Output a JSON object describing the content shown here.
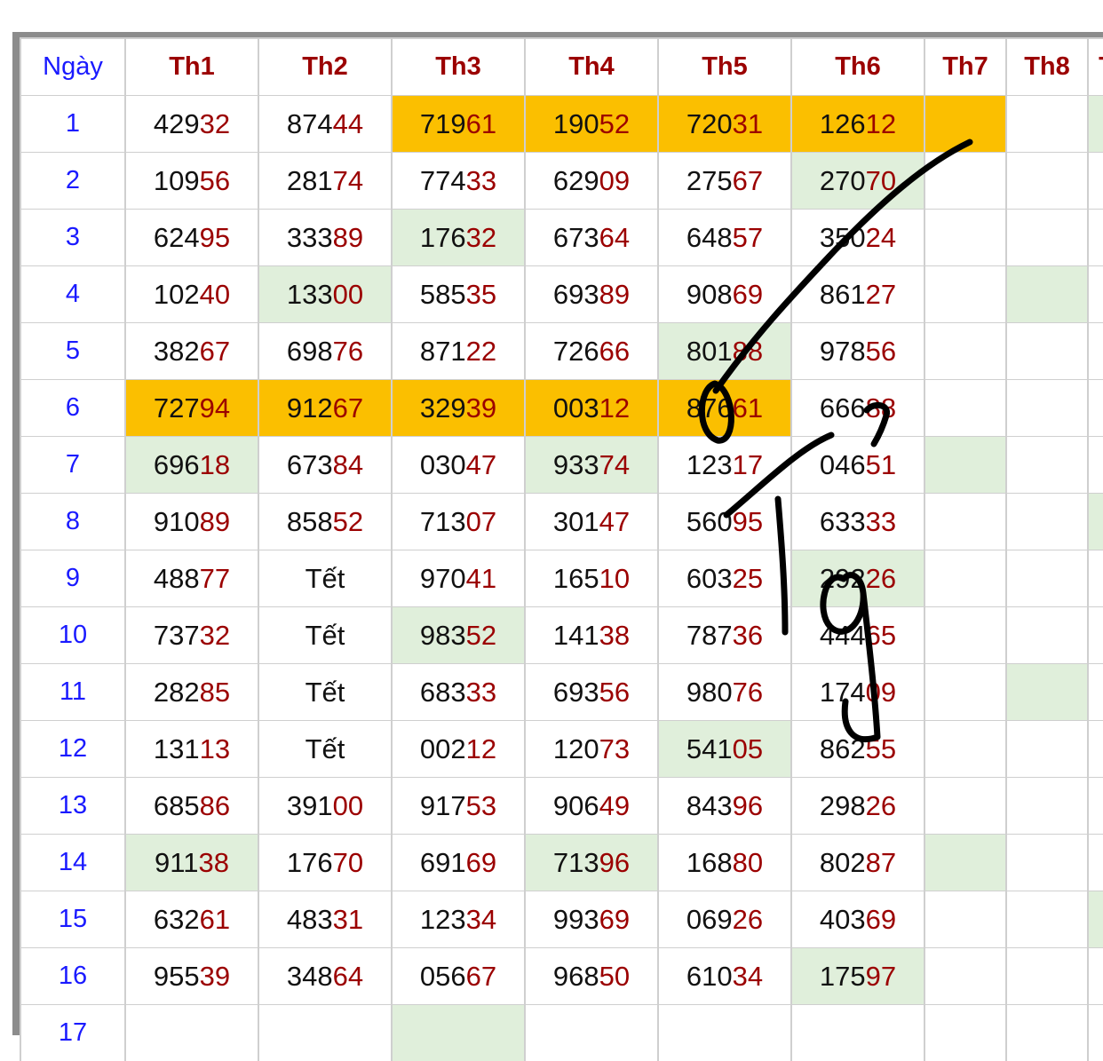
{
  "table": {
    "headers": [
      "Ngày",
      "Th1",
      "Th2",
      "Th3",
      "Th4",
      "Th5",
      "Th6",
      "Th7",
      "Th8",
      "T"
    ],
    "rows": [
      {
        "day": "1",
        "cells": [
          [
            "429",
            "32"
          ],
          [
            "874",
            "44"
          ],
          [
            "719",
            "61"
          ],
          [
            "190",
            "52"
          ],
          [
            "720",
            "31"
          ],
          [
            "126",
            "12"
          ],
          [
            "",
            ""
          ],
          [
            "",
            ""
          ],
          [
            "",
            ""
          ]
        ]
      },
      {
        "day": "2",
        "cells": [
          [
            "109",
            "56"
          ],
          [
            "281",
            "74"
          ],
          [
            "774",
            "33"
          ],
          [
            "629",
            "09"
          ],
          [
            "275",
            "67"
          ],
          [
            "270",
            "70"
          ],
          [
            "",
            ""
          ],
          [
            "",
            ""
          ],
          [
            "",
            ""
          ]
        ]
      },
      {
        "day": "3",
        "cells": [
          [
            "624",
            "95"
          ],
          [
            "333",
            "89"
          ],
          [
            "176",
            "32"
          ],
          [
            "673",
            "64"
          ],
          [
            "648",
            "57"
          ],
          [
            "350",
            "24"
          ],
          [
            "",
            ""
          ],
          [
            "",
            ""
          ],
          [
            "",
            ""
          ]
        ]
      },
      {
        "day": "4",
        "cells": [
          [
            "102",
            "40"
          ],
          [
            "133",
            "00"
          ],
          [
            "585",
            "35"
          ],
          [
            "693",
            "89"
          ],
          [
            "908",
            "69"
          ],
          [
            "861",
            "27"
          ],
          [
            "",
            ""
          ],
          [
            "",
            ""
          ],
          [
            "",
            ""
          ]
        ]
      },
      {
        "day": "5",
        "cells": [
          [
            "382",
            "67"
          ],
          [
            "698",
            "76"
          ],
          [
            "871",
            "22"
          ],
          [
            "726",
            "66"
          ],
          [
            "801",
            "88"
          ],
          [
            "978",
            "56"
          ],
          [
            "",
            ""
          ],
          [
            "",
            ""
          ],
          [
            "",
            ""
          ]
        ]
      },
      {
        "day": "6",
        "cells": [
          [
            "727",
            "94"
          ],
          [
            "912",
            "67"
          ],
          [
            "329",
            "39"
          ],
          [
            "003",
            "12"
          ],
          [
            "876",
            "61"
          ],
          [
            "666",
            "88"
          ],
          [
            "",
            ""
          ],
          [
            "",
            ""
          ],
          [
            "",
            ""
          ]
        ]
      },
      {
        "day": "7",
        "cells": [
          [
            "696",
            "18"
          ],
          [
            "673",
            "84"
          ],
          [
            "030",
            "47"
          ],
          [
            "933",
            "74"
          ],
          [
            "123",
            "17"
          ],
          [
            "046",
            "51"
          ],
          [
            "",
            ""
          ],
          [
            "",
            ""
          ],
          [
            "",
            ""
          ]
        ]
      },
      {
        "day": "8",
        "cells": [
          [
            "910",
            "89"
          ],
          [
            "858",
            "52"
          ],
          [
            "713",
            "07"
          ],
          [
            "301",
            "47"
          ],
          [
            "560",
            "95"
          ],
          [
            "633",
            "33"
          ],
          [
            "",
            ""
          ],
          [
            "",
            ""
          ],
          [
            "",
            ""
          ]
        ]
      },
      {
        "day": "9",
        "cells": [
          [
            "488",
            "77"
          ],
          [
            "Tết",
            ""
          ],
          [
            "970",
            "41"
          ],
          [
            "165",
            "10"
          ],
          [
            "603",
            "25"
          ],
          [
            "292",
            "26"
          ],
          [
            "",
            ""
          ],
          [
            "",
            ""
          ],
          [
            "",
            ""
          ]
        ]
      },
      {
        "day": "10",
        "cells": [
          [
            "737",
            "32"
          ],
          [
            "Tết",
            ""
          ],
          [
            "983",
            "52"
          ],
          [
            "141",
            "38"
          ],
          [
            "787",
            "36"
          ],
          [
            "444",
            "65"
          ],
          [
            "",
            ""
          ],
          [
            "",
            ""
          ],
          [
            "",
            ""
          ]
        ]
      },
      {
        "day": "11",
        "cells": [
          [
            "282",
            "85"
          ],
          [
            "Tết",
            ""
          ],
          [
            "683",
            "33"
          ],
          [
            "693",
            "56"
          ],
          [
            "980",
            "76"
          ],
          [
            "174",
            "09"
          ],
          [
            "",
            ""
          ],
          [
            "",
            ""
          ],
          [
            "",
            ""
          ]
        ]
      },
      {
        "day": "12",
        "cells": [
          [
            "131",
            "13"
          ],
          [
            "Tết",
            ""
          ],
          [
            "002",
            "12"
          ],
          [
            "120",
            "73"
          ],
          [
            "541",
            "05"
          ],
          [
            "862",
            "55"
          ],
          [
            "",
            ""
          ],
          [
            "",
            ""
          ],
          [
            "",
            ""
          ]
        ]
      },
      {
        "day": "13",
        "cells": [
          [
            "685",
            "86"
          ],
          [
            "391",
            "00"
          ],
          [
            "917",
            "53"
          ],
          [
            "906",
            "49"
          ],
          [
            "843",
            "96"
          ],
          [
            "298",
            "26"
          ],
          [
            "",
            ""
          ],
          [
            "",
            ""
          ],
          [
            "",
            ""
          ]
        ]
      },
      {
        "day": "14",
        "cells": [
          [
            "911",
            "38"
          ],
          [
            "176",
            "70"
          ],
          [
            "691",
            "69"
          ],
          [
            "713",
            "96"
          ],
          [
            "168",
            "80"
          ],
          [
            "802",
            "87"
          ],
          [
            "",
            ""
          ],
          [
            "",
            ""
          ],
          [
            "",
            ""
          ]
        ]
      },
      {
        "day": "15",
        "cells": [
          [
            "632",
            "61"
          ],
          [
            "483",
            "31"
          ],
          [
            "123",
            "34"
          ],
          [
            "993",
            "69"
          ],
          [
            "069",
            "26"
          ],
          [
            "403",
            "69"
          ],
          [
            "",
            ""
          ],
          [
            "",
            ""
          ],
          [
            "",
            ""
          ]
        ]
      },
      {
        "day": "16",
        "cells": [
          [
            "955",
            "39"
          ],
          [
            "348",
            "64"
          ],
          [
            "056",
            "67"
          ],
          [
            "968",
            "50"
          ],
          [
            "610",
            "34"
          ],
          [
            "175",
            "97"
          ],
          [
            "",
            ""
          ],
          [
            "",
            ""
          ],
          [
            "",
            ""
          ]
        ]
      },
      {
        "day": "17",
        "cells": [
          [
            "",
            ""
          ],
          [
            "",
            ""
          ],
          [
            "",
            ""
          ],
          [
            "",
            ""
          ],
          [
            "",
            ""
          ],
          [
            "",
            ""
          ],
          [
            "",
            ""
          ],
          [
            "",
            ""
          ],
          [
            "",
            ""
          ]
        ]
      }
    ],
    "highlights": {
      "yellow": [
        [
          1,
          3
        ],
        [
          1,
          4
        ],
        [
          1,
          5
        ],
        [
          1,
          6
        ],
        [
          1,
          7
        ],
        [
          6,
          1
        ],
        [
          6,
          2
        ],
        [
          6,
          3
        ],
        [
          6,
          4
        ],
        [
          6,
          5
        ]
      ],
      "green": [
        [
          1,
          9
        ],
        [
          2,
          6
        ],
        [
          3,
          3
        ],
        [
          4,
          2
        ],
        [
          4,
          8
        ],
        [
          5,
          5
        ],
        [
          7,
          1
        ],
        [
          7,
          4
        ],
        [
          7,
          7
        ],
        [
          8,
          9
        ],
        [
          9,
          6
        ],
        [
          10,
          3
        ],
        [
          11,
          8
        ],
        [
          12,
          5
        ],
        [
          14,
          1
        ],
        [
          14,
          4
        ],
        [
          14,
          7
        ],
        [
          15,
          9
        ],
        [
          16,
          6
        ],
        [
          17,
          3
        ]
      ]
    },
    "colors": {
      "yellow": "#fbbf00",
      "green": "#e0efdb",
      "header_red": "#9b0000",
      "day_blue": "#1a1aff"
    }
  }
}
